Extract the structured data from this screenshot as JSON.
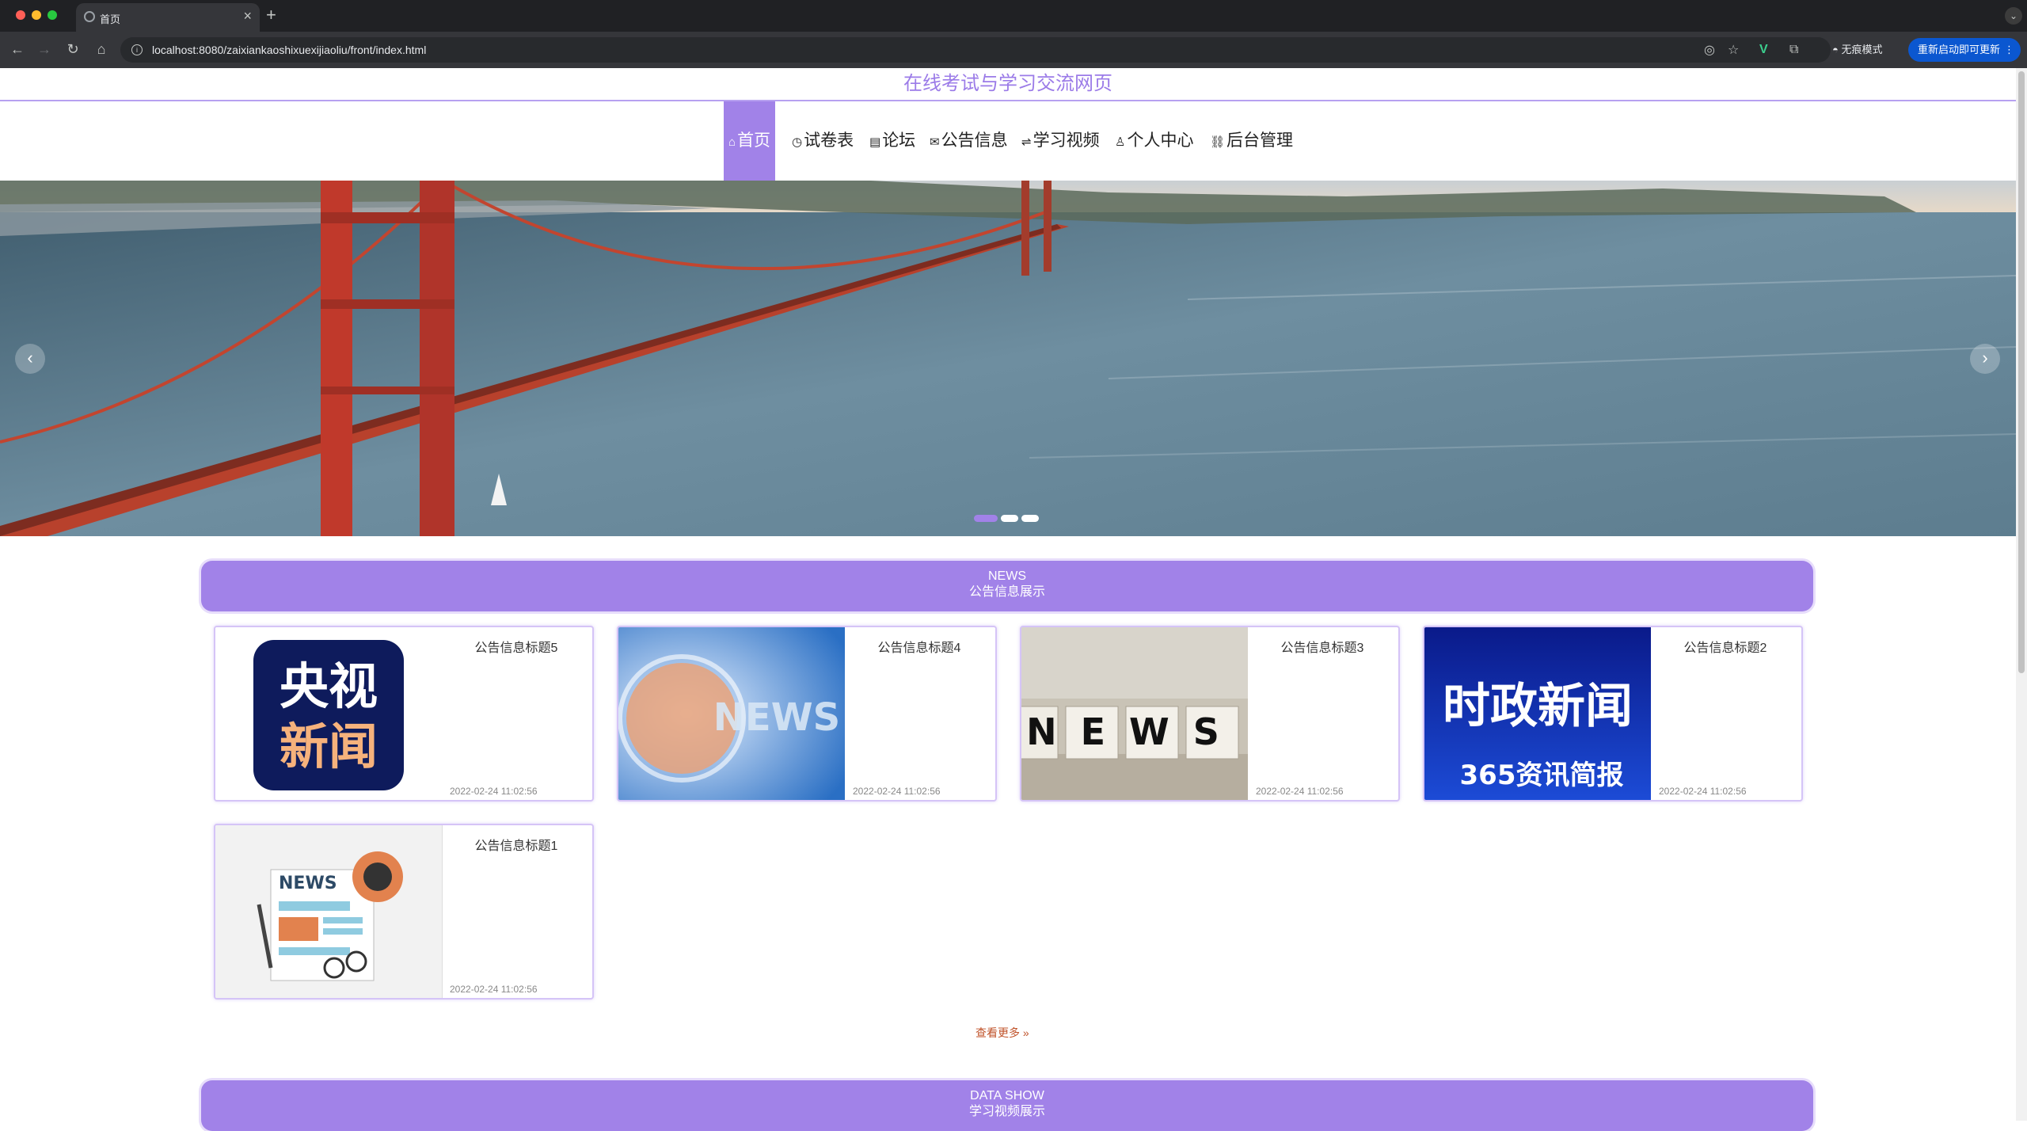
{
  "browser": {
    "tab_title": "首页",
    "url": "localhost:8080/zaixiankaoshixuexijiaoliu/front/index.html",
    "incognito_label": "无痕模式",
    "update_label": "重新启动即可更新"
  },
  "site": {
    "title": "在线考试与学习交流网页"
  },
  "nav": {
    "items": [
      {
        "icon": "home-icon",
        "label": "首页",
        "active": true
      },
      {
        "icon": "clock-icon",
        "label": "试卷表"
      },
      {
        "icon": "document-icon",
        "label": "论坛"
      },
      {
        "icon": "mail-icon",
        "label": "公告信息"
      },
      {
        "icon": "sliders-icon",
        "label": "学习视频"
      },
      {
        "icon": "user-icon",
        "label": "个人中心"
      },
      {
        "icon": "link-icon",
        "label": "后台管理"
      }
    ]
  },
  "banner": {
    "slide_count": 3,
    "active_index": 0
  },
  "news_section": {
    "title_en": "NEWS",
    "title_cn": "公告信息展示",
    "items": [
      {
        "title": "公告信息标题5",
        "time": "2022-02-24 11:02:56",
        "image_text": [
          "央视",
          "新闻"
        ]
      },
      {
        "title": "公告信息标题4",
        "time": "2022-02-24 11:02:56",
        "image_text": [
          "NEWS"
        ]
      },
      {
        "title": "公告信息标题3",
        "time": "2022-02-24 11:02:56",
        "image_text": [
          "NEWS"
        ]
      },
      {
        "title": "公告信息标题2",
        "time": "2022-02-24 11:02:56",
        "image_text": [
          "时政新闻",
          "365资讯简报"
        ]
      },
      {
        "title": "公告信息标题1",
        "time": "2022-02-24 11:02:56",
        "image_text": [
          "NEWS"
        ]
      }
    ],
    "more_label": "查看更多"
  },
  "data_section": {
    "title_en": "DATA SHOW",
    "title_cn": "学习视频展示"
  },
  "colors": {
    "accent": "#a182e8",
    "title": "#9b7be8",
    "more_link": "#c0532a"
  }
}
